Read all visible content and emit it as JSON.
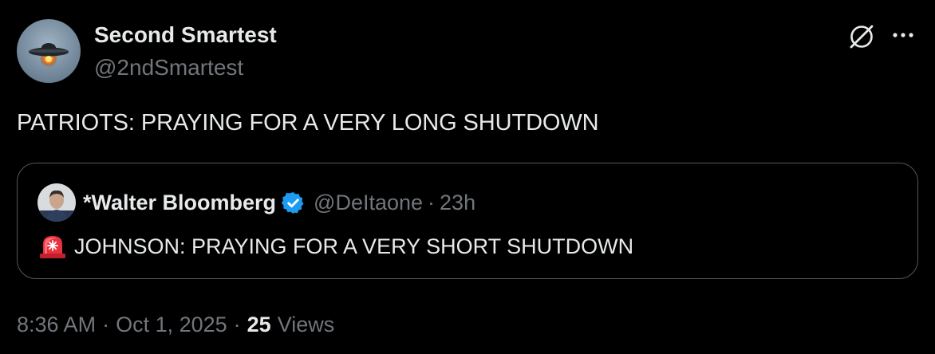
{
  "tweet": {
    "author": {
      "name": "Second Smartest",
      "handle": "@2ndSmartest",
      "avatar_icon": "ufo-icon"
    },
    "actions": {
      "grok_icon": "grok-icon",
      "more_icon": "more-dots-icon"
    },
    "text": "PATRIOTS: PRAYING FOR A VERY LONG SHUTDOWN",
    "quote": {
      "author_name": "*Walter Bloomberg",
      "verified_icon": "verified-badge-icon",
      "handle": "@DeItaone",
      "separator": "·",
      "time": "23h",
      "emoji_icon": "siren-icon",
      "text": "JOHNSON: PRAYING FOR A VERY SHORT SHUTDOWN"
    },
    "meta": {
      "time": "8:36 AM",
      "separator": "·",
      "date": "Oct 1, 2025",
      "views_count": "25",
      "views_label": "Views"
    }
  },
  "colors": {
    "background": "#000000",
    "text_primary": "#e7e9ea",
    "text_secondary": "#71767b",
    "border": "#52575c",
    "verified_blue": "#1d9bf0"
  }
}
